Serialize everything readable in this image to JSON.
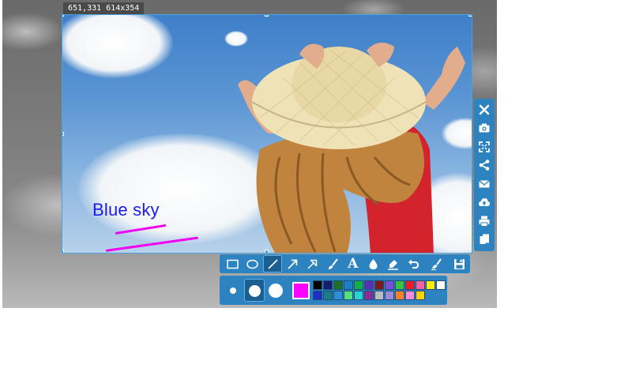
{
  "selection": {
    "size_label": "651,331 614x354"
  },
  "annotation": {
    "text": "Blue sky",
    "text_color": "#1a1aee",
    "stroke_color": "#f200f2"
  },
  "side_toolbar": {
    "items": [
      {
        "name": "close",
        "icon": "close-icon"
      },
      {
        "name": "capture",
        "icon": "camera-icon"
      },
      {
        "name": "fullscreen",
        "icon": "fullscreen-icon"
      },
      {
        "name": "share",
        "icon": "share-icon"
      },
      {
        "name": "email",
        "icon": "mail-icon"
      },
      {
        "name": "upload",
        "icon": "cloud-upload-icon"
      },
      {
        "name": "print",
        "icon": "print-icon"
      },
      {
        "name": "copy",
        "icon": "copy-icon"
      }
    ]
  },
  "draw_toolbar": {
    "tools": [
      {
        "name": "rectangle",
        "icon": "rectangle-icon"
      },
      {
        "name": "ellipse",
        "icon": "ellipse-icon"
      },
      {
        "name": "line",
        "icon": "line-icon",
        "active": true
      },
      {
        "name": "arrow",
        "icon": "arrow-icon"
      },
      {
        "name": "arrow-outline",
        "icon": "outline-arrow-icon"
      },
      {
        "name": "brush",
        "icon": "brush-icon"
      },
      {
        "name": "text",
        "icon": "text-icon",
        "label": "A"
      },
      {
        "name": "blur",
        "icon": "droplet-icon"
      },
      {
        "name": "highlighter",
        "icon": "highlighter-icon"
      },
      {
        "name": "undo",
        "icon": "undo-icon"
      },
      {
        "name": "clear",
        "icon": "eraser-icon"
      },
      {
        "name": "save",
        "icon": "save-icon"
      }
    ]
  },
  "options": {
    "sizes": [
      "small",
      "medium",
      "large"
    ],
    "selected_size": "medium",
    "current_color": "#ff00ff",
    "palette": [
      "#000000",
      "#1a1a6e",
      "#1f6f2a",
      "#1e7fc6",
      "#12b04a",
      "#5b2fb5",
      "#7b1b1b",
      "#7a4fd6",
      "#3cc23c",
      "#ee1c24",
      "#ff5fa0",
      "#ffef00",
      "#ffffff",
      "#1e2ec7",
      "#1e7b8a",
      "#2d8fd8",
      "#53e07a",
      "#2bd3d3",
      "#8e2b94",
      "#bcbcbc",
      "#9a8bd9",
      "#ff7f27",
      "#ff8ad8",
      "#ffd200"
    ]
  }
}
